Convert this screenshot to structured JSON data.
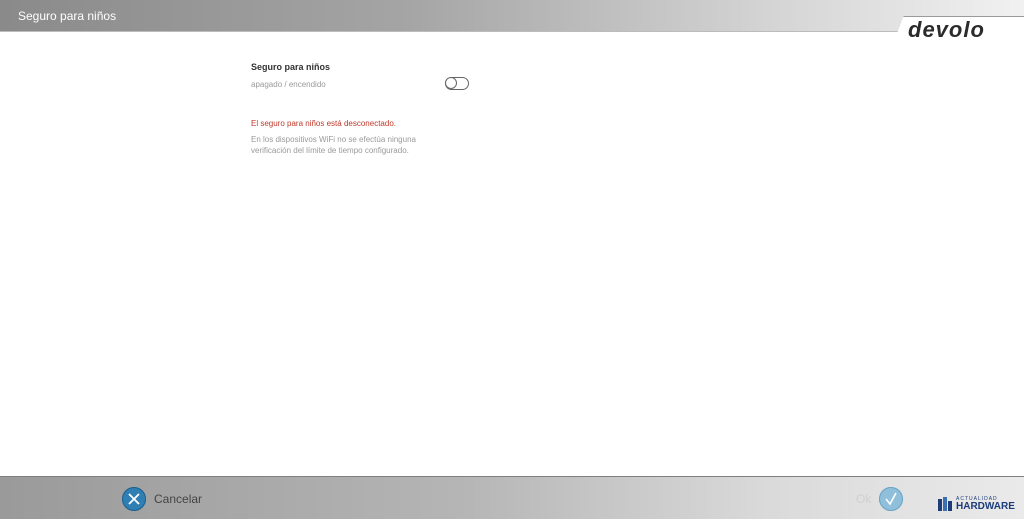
{
  "header": {
    "title": "Seguro para niños",
    "logo": "devolo"
  },
  "content": {
    "section_title": "Seguro para niños",
    "toggle_label": "apagado / encendido",
    "toggle_state": "off",
    "status_message": "El seguro para niños está desconectado.",
    "description": "En los dispositivos WiFi no se efectúa ninguna verificación del límite de tiempo configurado."
  },
  "footer": {
    "cancel_label": "Cancelar",
    "cancel_icon": "close-icon",
    "ok_label": "Ok",
    "ok_icon": "check-icon"
  },
  "watermark": {
    "line1": "ACTUALIDAD",
    "line2": "HARDWARE"
  },
  "colors": {
    "status_red": "#c0392b",
    "button_blue": "#2f7fb5",
    "ok_disabled_blue": "#8fbfdb"
  }
}
